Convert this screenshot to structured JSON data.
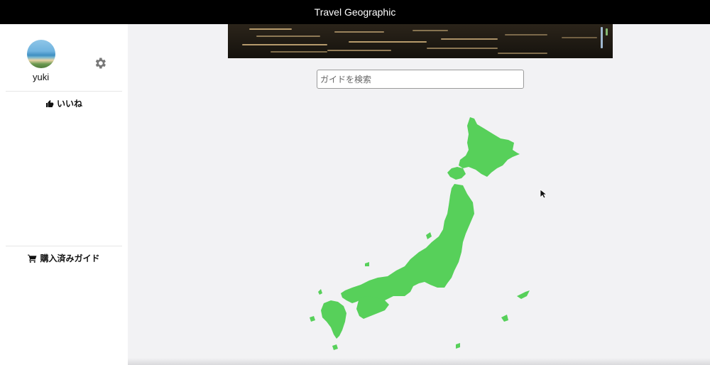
{
  "app": {
    "title": "Travel Geographic"
  },
  "sidebar": {
    "username": "yuki",
    "menu": [
      {
        "label": "いいね",
        "icon": "thumbs-up-icon"
      },
      {
        "label": "購入済みガイド",
        "icon": "cart-icon"
      }
    ]
  },
  "search": {
    "placeholder": "ガイドを検索",
    "value": ""
  },
  "map": {
    "region": "Japan",
    "color": "#57d05a"
  },
  "colors": {
    "topbar": "#000000",
    "background": "#f2f2f4",
    "sidebar": "#ffffff"
  }
}
